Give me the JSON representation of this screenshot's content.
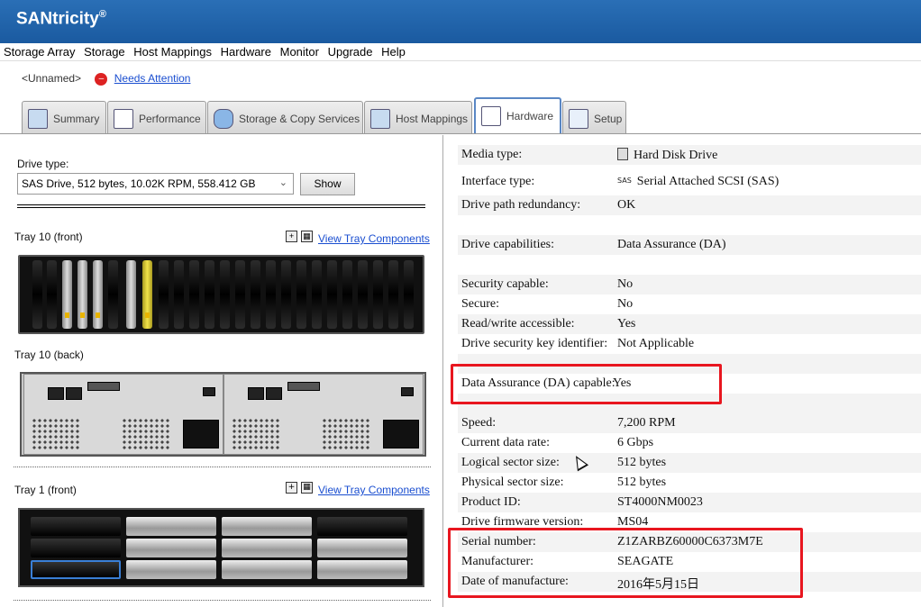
{
  "app": {
    "brand": "SANtricity",
    "reg": "®"
  },
  "menu": [
    "Storage Array",
    "Storage",
    "Host Mappings",
    "Hardware",
    "Monitor",
    "Upgrade",
    "Help"
  ],
  "status": {
    "array_name": "<Unnamed>",
    "attention_link": "Needs Attention"
  },
  "tabs": [
    {
      "label": "Summary",
      "icon": "summary-icon"
    },
    {
      "label": "Performance",
      "icon": "performance-icon"
    },
    {
      "label": "Storage & Copy Services",
      "icon": "storage-icon"
    },
    {
      "label": "Host Mappings",
      "icon": "host-mappings-icon"
    },
    {
      "label": "Hardware",
      "icon": "hardware-icon",
      "active": true
    },
    {
      "label": "Setup",
      "icon": "setup-icon"
    }
  ],
  "left": {
    "drive_type_label": "Drive type:",
    "drive_type_value": "SAS Drive, 512 bytes, 10.02K RPM, 558.412 GB",
    "show_button": "Show",
    "tray10_front_label": "Tray 10 (front)",
    "tray10_back_label": "Tray 10 (back)",
    "tray1_front_label": "Tray 1 (front)",
    "view_tray_components": "View Tray Components"
  },
  "properties": [
    {
      "key": "Media type:",
      "value": "Hard Disk Drive",
      "icon": "hdd-icon"
    },
    {
      "key": "Interface type:",
      "value": "Serial Attached SCSI (SAS)",
      "icon": "sas-icon",
      "icon_text": "SAS"
    },
    {
      "key": "Drive path redundancy:",
      "value": "OK"
    },
    {
      "key": "Drive capabilities:",
      "value": "Data Assurance (DA)"
    },
    {
      "key": "Security capable:",
      "value": "No"
    },
    {
      "key": "Secure:",
      "value": "No"
    },
    {
      "key": "Read/write accessible:",
      "value": "Yes"
    },
    {
      "key": "Drive security key identifier:",
      "value": "Not Applicable"
    },
    {
      "key": "Data Assurance (DA) capable:",
      "value": "Yes"
    },
    {
      "key": "Speed:",
      "value": "7,200 RPM"
    },
    {
      "key": "Current data rate:",
      "value": "6 Gbps"
    },
    {
      "key": "Logical sector size:",
      "value": "512 bytes"
    },
    {
      "key": "Physical sector size:",
      "value": "512 bytes"
    },
    {
      "key": "Product ID:",
      "value": "ST4000NM0023"
    },
    {
      "key": "Drive firmware version:",
      "value": "MS04"
    },
    {
      "key": "Serial number:",
      "value": "Z1ZARBZ60000C6373M7E"
    },
    {
      "key": "Manufacturer:",
      "value": "SEAGATE"
    },
    {
      "key": "Date of manufacture:",
      "value": "2016年5月15日"
    }
  ],
  "colors": {
    "highlight_box": "#e8161f",
    "title_bar": "#1f62ab",
    "link": "#1a4ed0"
  }
}
